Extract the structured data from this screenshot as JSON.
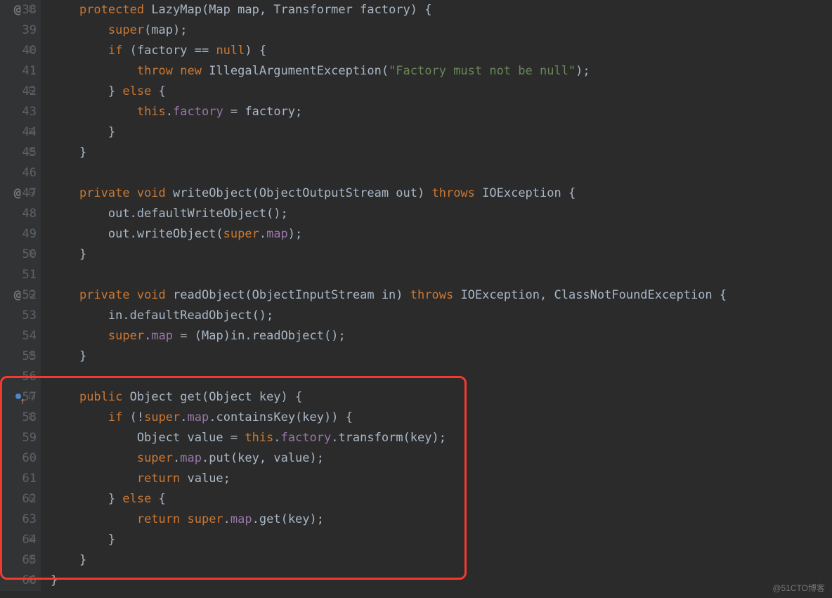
{
  "watermark": "@51CTO博客",
  "gutter_start": 38,
  "lines": [
    {
      "num": 38,
      "annot": "@",
      "fold": "open",
      "tokens": [
        {
          "t": "    ",
          "c": "punc"
        },
        {
          "t": "protected ",
          "c": "kw"
        },
        {
          "t": "LazyMap(Map map, Transformer factory) {",
          "c": "object"
        }
      ]
    },
    {
      "num": 39,
      "tokens": [
        {
          "t": "        ",
          "c": "punc"
        },
        {
          "t": "super",
          "c": "kw"
        },
        {
          "t": "(map);",
          "c": "object"
        }
      ]
    },
    {
      "num": 40,
      "fold": "open",
      "tokens": [
        {
          "t": "        ",
          "c": "punc"
        },
        {
          "t": "if ",
          "c": "kw"
        },
        {
          "t": "(factory == ",
          "c": "object"
        },
        {
          "t": "null",
          "c": "kw"
        },
        {
          "t": ") {",
          "c": "object"
        }
      ]
    },
    {
      "num": 41,
      "tokens": [
        {
          "t": "            ",
          "c": "punc"
        },
        {
          "t": "throw new ",
          "c": "kw"
        },
        {
          "t": "IllegalArgumentException(",
          "c": "object"
        },
        {
          "t": "\"Factory must not be null\"",
          "c": "str"
        },
        {
          "t": ");",
          "c": "object"
        }
      ]
    },
    {
      "num": 42,
      "fold": "open",
      "tokens": [
        {
          "t": "        } ",
          "c": "object"
        },
        {
          "t": "else ",
          "c": "kw"
        },
        {
          "t": "{",
          "c": "object"
        }
      ]
    },
    {
      "num": 43,
      "tokens": [
        {
          "t": "            ",
          "c": "punc"
        },
        {
          "t": "this",
          "c": "kw"
        },
        {
          "t": ".",
          "c": "object"
        },
        {
          "t": "factory",
          "c": "field"
        },
        {
          "t": " = factory;",
          "c": "object"
        }
      ]
    },
    {
      "num": 44,
      "fold": "close",
      "tokens": [
        {
          "t": "        }",
          "c": "object"
        }
      ]
    },
    {
      "num": 45,
      "fold": "close",
      "tokens": [
        {
          "t": "    }",
          "c": "object"
        }
      ]
    },
    {
      "num": 46,
      "tokens": [
        {
          "t": "",
          "c": "object"
        }
      ]
    },
    {
      "num": 47,
      "annot": "@",
      "fold": "open",
      "tokens": [
        {
          "t": "    ",
          "c": "punc"
        },
        {
          "t": "private void ",
          "c": "kw"
        },
        {
          "t": "writeObject(ObjectOutputStream out) ",
          "c": "object"
        },
        {
          "t": "throws ",
          "c": "kw"
        },
        {
          "t": "IOException {",
          "c": "object"
        }
      ]
    },
    {
      "num": 48,
      "tokens": [
        {
          "t": "        out.defaultWriteObject();",
          "c": "object"
        }
      ]
    },
    {
      "num": 49,
      "tokens": [
        {
          "t": "        out.writeObject(",
          "c": "object"
        },
        {
          "t": "super",
          "c": "kw"
        },
        {
          "t": ".",
          "c": "object"
        },
        {
          "t": "map",
          "c": "field"
        },
        {
          "t": ");",
          "c": "object"
        }
      ]
    },
    {
      "num": 50,
      "fold": "close",
      "tokens": [
        {
          "t": "    }",
          "c": "object"
        }
      ]
    },
    {
      "num": 51,
      "tokens": [
        {
          "t": "",
          "c": "object"
        }
      ]
    },
    {
      "num": 52,
      "annot": "@",
      "fold": "open",
      "tokens": [
        {
          "t": "    ",
          "c": "punc"
        },
        {
          "t": "private void ",
          "c": "kw"
        },
        {
          "t": "readObject(ObjectInputStream in) ",
          "c": "object"
        },
        {
          "t": "throws ",
          "c": "kw"
        },
        {
          "t": "IOException, ClassNotFoundException {",
          "c": "object"
        }
      ]
    },
    {
      "num": 53,
      "tokens": [
        {
          "t": "        in.defaultReadObject();",
          "c": "object"
        }
      ]
    },
    {
      "num": 54,
      "tokens": [
        {
          "t": "        ",
          "c": "object"
        },
        {
          "t": "super",
          "c": "kw"
        },
        {
          "t": ".",
          "c": "object"
        },
        {
          "t": "map",
          "c": "field"
        },
        {
          "t": " = (Map)in.readObject();",
          "c": "object"
        }
      ]
    },
    {
      "num": 55,
      "fold": "close",
      "tokens": [
        {
          "t": "    }",
          "c": "object"
        }
      ]
    },
    {
      "num": 56,
      "tokens": [
        {
          "t": "",
          "c": "object"
        }
      ]
    },
    {
      "num": 57,
      "override": true,
      "fold": "open",
      "tokens": [
        {
          "t": "    ",
          "c": "punc"
        },
        {
          "t": "public ",
          "c": "kw"
        },
        {
          "t": "Object get(Object key) {",
          "c": "object"
        }
      ]
    },
    {
      "num": 58,
      "fold": "open",
      "tokens": [
        {
          "t": "        ",
          "c": "punc"
        },
        {
          "t": "if ",
          "c": "kw"
        },
        {
          "t": "(!",
          "c": "object"
        },
        {
          "t": "super",
          "c": "kw"
        },
        {
          "t": ".",
          "c": "object"
        },
        {
          "t": "map",
          "c": "field"
        },
        {
          "t": ".containsKey(key)) {",
          "c": "object"
        }
      ]
    },
    {
      "num": 59,
      "tokens": [
        {
          "t": "            Object value = ",
          "c": "object"
        },
        {
          "t": "this",
          "c": "kw"
        },
        {
          "t": ".",
          "c": "object"
        },
        {
          "t": "factory",
          "c": "field"
        },
        {
          "t": ".transform(key);",
          "c": "object"
        }
      ]
    },
    {
      "num": 60,
      "tokens": [
        {
          "t": "            ",
          "c": "object"
        },
        {
          "t": "super",
          "c": "kw"
        },
        {
          "t": ".",
          "c": "object"
        },
        {
          "t": "map",
          "c": "field"
        },
        {
          "t": ".put(key, value);",
          "c": "object"
        }
      ]
    },
    {
      "num": 61,
      "tokens": [
        {
          "t": "            ",
          "c": "object"
        },
        {
          "t": "return ",
          "c": "kw"
        },
        {
          "t": "value;",
          "c": "object"
        }
      ]
    },
    {
      "num": 62,
      "fold": "open",
      "tokens": [
        {
          "t": "        } ",
          "c": "object"
        },
        {
          "t": "else ",
          "c": "kw"
        },
        {
          "t": "{",
          "c": "object"
        }
      ]
    },
    {
      "num": 63,
      "tokens": [
        {
          "t": "            ",
          "c": "object"
        },
        {
          "t": "return ",
          "c": "kw"
        },
        {
          "t": "super",
          "c": "kw"
        },
        {
          "t": ".",
          "c": "object"
        },
        {
          "t": "map",
          "c": "field"
        },
        {
          "t": ".get(key);",
          "c": "object"
        }
      ]
    },
    {
      "num": 64,
      "fold": "close",
      "tokens": [
        {
          "t": "        }",
          "c": "object"
        }
      ]
    },
    {
      "num": 65,
      "fold": "close",
      "tokens": [
        {
          "t": "    }",
          "c": "object"
        }
      ]
    },
    {
      "num": 66,
      "fold": "close",
      "tokens": [
        {
          "t": "}",
          "c": "object"
        }
      ]
    }
  ]
}
